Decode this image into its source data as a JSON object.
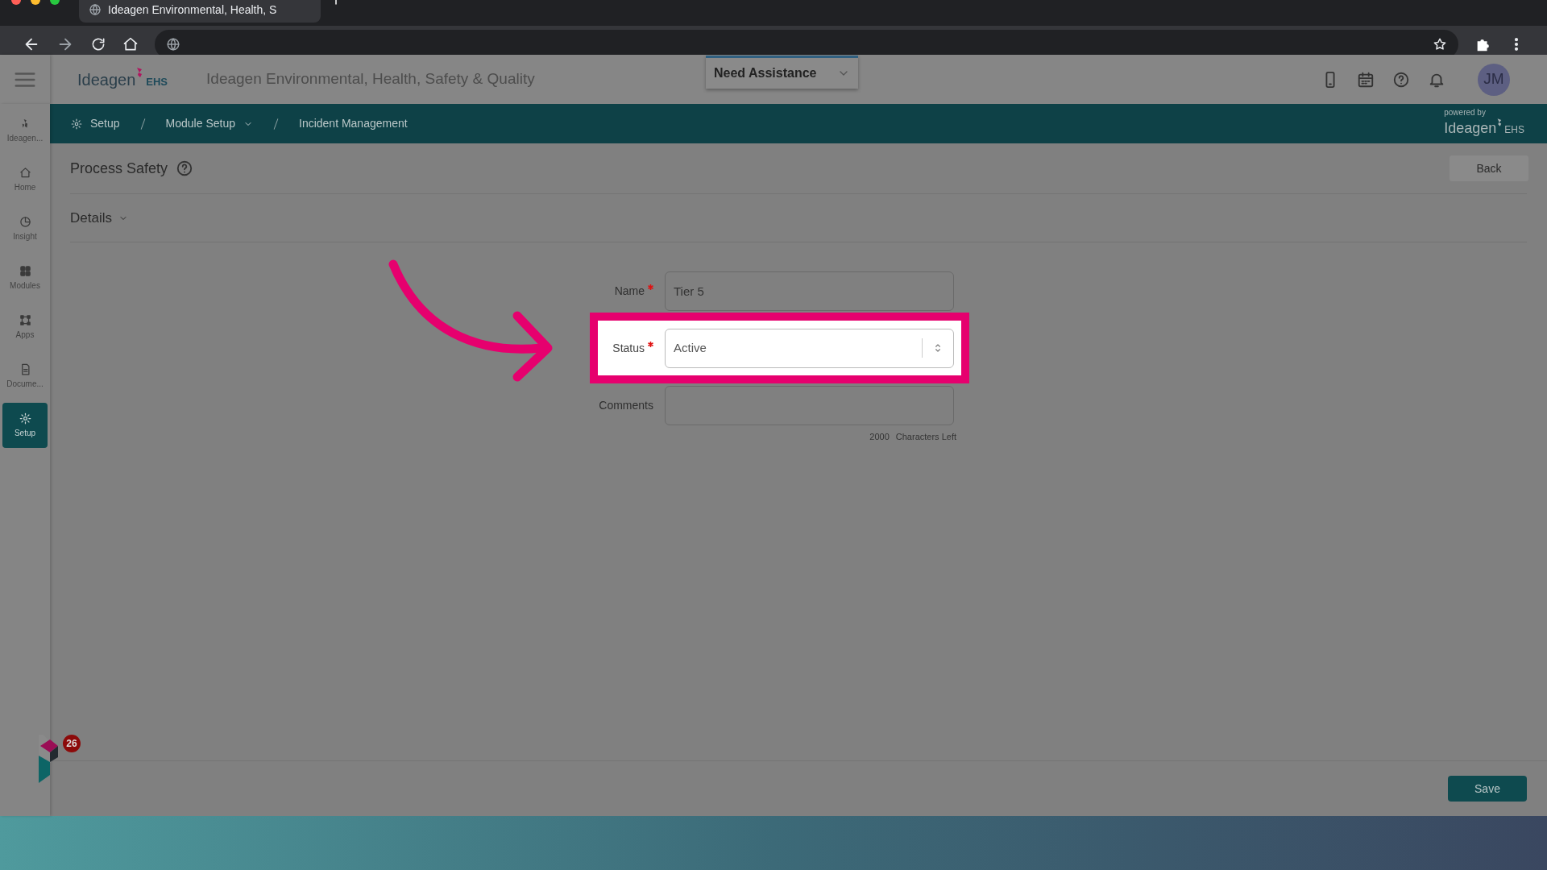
{
  "browser": {
    "tab_title": "Ideagen Environmental, Health, S"
  },
  "header": {
    "logo": {
      "name": "Ideagen",
      "suffix": "EHS"
    },
    "app_title": "Ideagen Environmental, Health, Safety & Quality",
    "assistance": {
      "value": "Need Assistance"
    },
    "avatar": "JM"
  },
  "sidebar": {
    "items": [
      {
        "kind": "logo",
        "label": "Ideagen...",
        "selected": false
      },
      {
        "kind": "home",
        "label": "Home",
        "selected": false
      },
      {
        "kind": "insight",
        "label": "Insight",
        "selected": false
      },
      {
        "kind": "modules",
        "label": "Modules",
        "selected": false
      },
      {
        "kind": "apps",
        "label": "Apps",
        "selected": false
      },
      {
        "kind": "document",
        "label": "Docume...",
        "selected": false
      },
      {
        "kind": "setup",
        "label": "Setup",
        "selected": true
      }
    ]
  },
  "breadcrumbs": [
    {
      "label": "Setup",
      "dropdown": false
    },
    {
      "label": "Module Setup",
      "dropdown": true
    },
    {
      "label": "Incident Management",
      "dropdown": false
    }
  ],
  "powered_by": {
    "caption": "powered by",
    "name": "Ideagen",
    "suffix": "EHS"
  },
  "page": {
    "title": "Process Safety",
    "back": "Back",
    "section": {
      "label": "Details",
      "expanded": true
    }
  },
  "form": {
    "fields": [
      {
        "kind": "input",
        "label": "Name",
        "required": true,
        "value": "Tier 5",
        "highlighted": false
      },
      {
        "kind": "select",
        "label": "Status",
        "required": true,
        "value": "Active",
        "highlighted": true
      },
      {
        "kind": "textarea",
        "label": "Comments",
        "required": false,
        "highlighted": false
      }
    ],
    "chars_left": {
      "count": "2000",
      "label": "Characters Left"
    }
  },
  "notification_badge": "26",
  "save": "Save"
}
